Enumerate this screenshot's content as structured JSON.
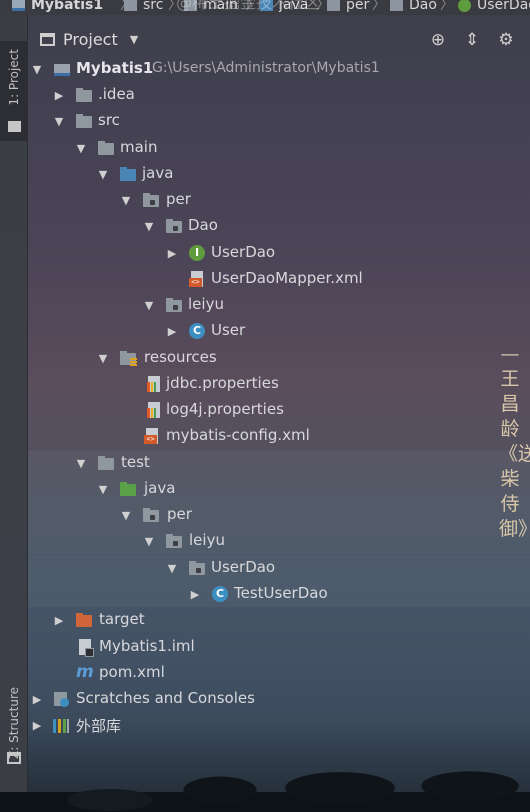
{
  "breadcrumb": [
    {
      "label": "Mybatis1",
      "icon": "module-icon"
    },
    {
      "label": "src",
      "icon": "folder-icon"
    },
    {
      "label": "main",
      "icon": "folder-icon"
    },
    {
      "label": "java",
      "icon": "source-folder-icon"
    },
    {
      "label": "per",
      "icon": "package-icon"
    },
    {
      "label": "Dao",
      "icon": "package-icon"
    },
    {
      "label": "UserDao",
      "icon": "interface-icon"
    }
  ],
  "watermark": "@稀土掘金技术社区",
  "tool_strip": {
    "project_tab": "1: Project",
    "structure_tab": "Z: Structure"
  },
  "header": {
    "title": "Project",
    "caret": "▼",
    "tools": [
      "⊕",
      "⇕",
      "⚙"
    ]
  },
  "tree": [
    {
      "label": "Mybatis1",
      "path": "G:\\Users\\Administrator\\Mybatis1",
      "arrow": "▼",
      "icon": "module-icon"
    },
    {
      "label": ".idea",
      "arrow": "▶",
      "icon": "folder-icon"
    },
    {
      "label": "src",
      "arrow": "▼",
      "icon": "folder-icon"
    },
    {
      "label": "main",
      "arrow": "▼",
      "icon": "folder-icon"
    },
    {
      "label": "java",
      "arrow": "▼",
      "icon": "source-folder-icon"
    },
    {
      "label": "per",
      "arrow": "▼",
      "icon": "package-icon"
    },
    {
      "label": "Dao",
      "arrow": "▼",
      "icon": "package-icon"
    },
    {
      "label": "UserDao",
      "arrow": "▶",
      "icon": "interface-icon",
      "glyph": "I"
    },
    {
      "label": "UserDaoMapper.xml",
      "arrow": "",
      "icon": "xml-file-icon"
    },
    {
      "label": "leiyu",
      "arrow": "▼",
      "icon": "package-icon"
    },
    {
      "label": "User",
      "arrow": "▶",
      "icon": "class-icon",
      "glyph": "C"
    },
    {
      "label": "resources",
      "arrow": "▼",
      "icon": "resources-folder-icon"
    },
    {
      "label": "jdbc.properties",
      "arrow": "",
      "icon": "properties-file-icon"
    },
    {
      "label": "log4j.properties",
      "arrow": "",
      "icon": "properties-file-icon"
    },
    {
      "label": "mybatis-config.xml",
      "arrow": "",
      "icon": "xml-file-icon"
    },
    {
      "label": "test",
      "arrow": "▼",
      "icon": "folder-icon"
    },
    {
      "label": "java",
      "arrow": "▼",
      "icon": "test-source-folder-icon"
    },
    {
      "label": "per",
      "arrow": "▼",
      "icon": "package-icon"
    },
    {
      "label": "leiyu",
      "arrow": "▼",
      "icon": "package-icon"
    },
    {
      "label": "UserDao",
      "arrow": "▼",
      "icon": "package-icon"
    },
    {
      "label": "TestUserDao",
      "arrow": "▶",
      "icon": "test-class-icon",
      "glyph": "C"
    },
    {
      "label": "target",
      "arrow": "▶",
      "icon": "excluded-folder-icon"
    },
    {
      "label": "Mybatis1.iml",
      "arrow": "",
      "icon": "iml-file-icon"
    },
    {
      "label": "pom.xml",
      "arrow": "",
      "icon": "maven-icon",
      "glyph": "m"
    },
    {
      "label": "Scratches and Consoles",
      "arrow": "▶",
      "icon": "scratches-icon"
    },
    {
      "label": "外部库",
      "arrow": "▶",
      "icon": "library-icon"
    }
  ],
  "poem": "—王昌龄《送柴侍御》"
}
